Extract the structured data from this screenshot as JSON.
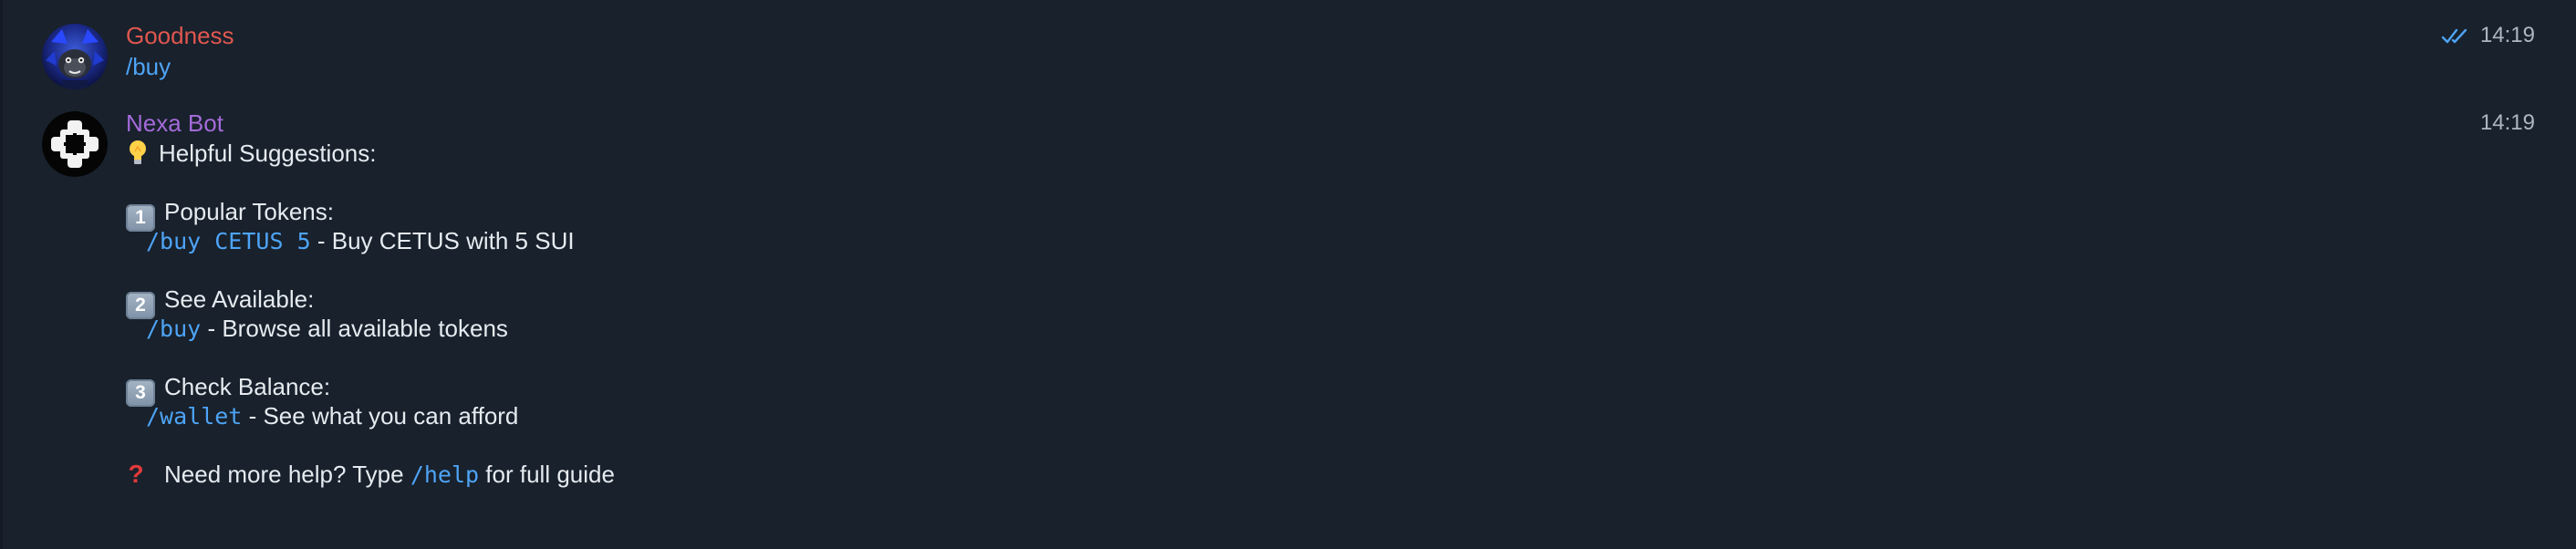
{
  "messages": [
    {
      "sender": "Goodness",
      "time": "14:19",
      "read_status": "double-check",
      "command": "/buy"
    },
    {
      "sender": "Nexa Bot",
      "time": "14:19",
      "intro": "Helpful Suggestions:",
      "sections": [
        {
          "number": "1",
          "title": "Popular Tokens:",
          "code": "/buy CETUS 5",
          "description": " - Buy CETUS with 5 SUI"
        },
        {
          "number": "2",
          "title": "See Available:",
          "code": "/buy",
          "description": " - Browse all available tokens"
        },
        {
          "number": "3",
          "title": "Check Balance:",
          "code": "/wallet",
          "description": " - See what you can afford"
        }
      ],
      "help_prefix": "Need more help? Type ",
      "help_code": "/help",
      "help_suffix": " for full guide"
    }
  ],
  "icons": {
    "intro_icon": "light-bulb-icon",
    "help_icon": "question-mark-icon",
    "read_icon": "double-check-icon"
  },
  "colors": {
    "background": "#18212c",
    "sender_user": "#e0574f",
    "sender_bot": "#a46ad9",
    "link": "#4ea4f6",
    "text": "#e6ebf0",
    "time": "#aeb7c1"
  }
}
